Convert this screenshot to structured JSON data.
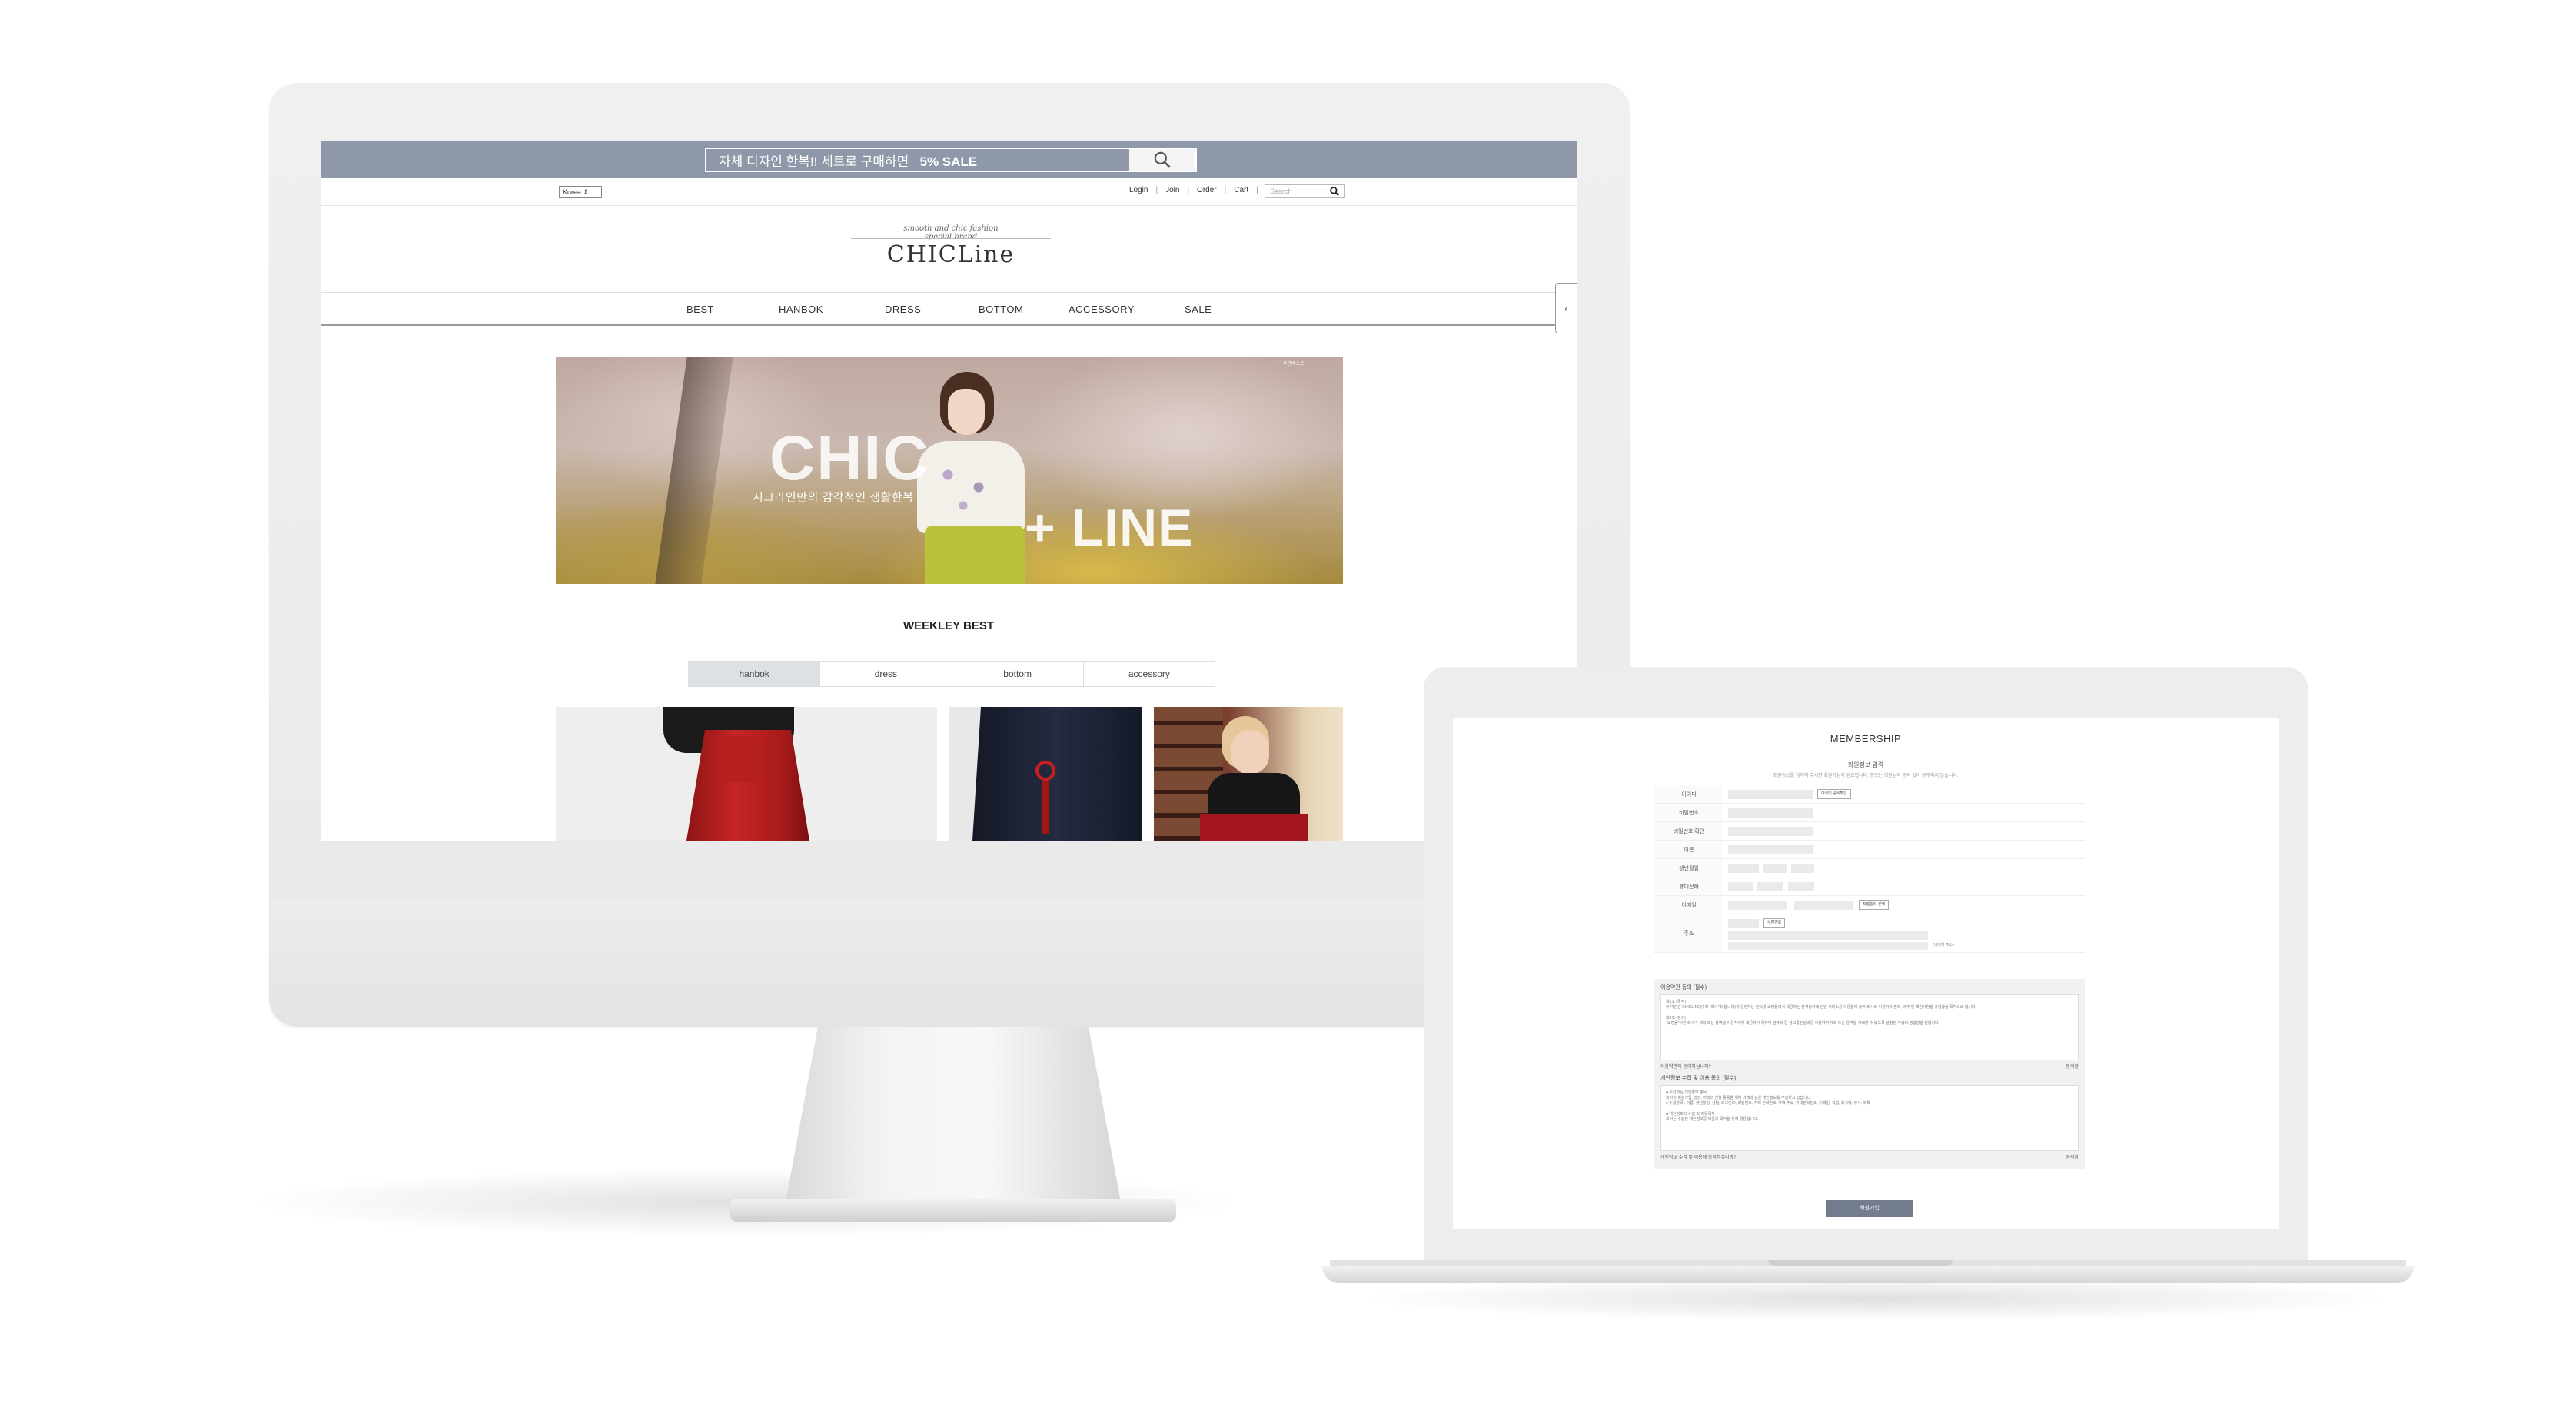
{
  "desktop": {
    "promo": {
      "text": "자체 디자인 한복!! 세트로 구매하면",
      "highlight": "5% SALE"
    },
    "util": {
      "language": "Korea",
      "links": [
        "Login",
        "Join",
        "Order",
        "Cart"
      ],
      "search_placeholder": "Search"
    },
    "logo": {
      "tagline": "smooth and chic fashion special brand",
      "name": "CHICLine"
    },
    "nav": [
      "BEST",
      "HANBOK",
      "DRESS",
      "BOTTOM",
      "ACCESSORY",
      "SALE"
    ],
    "banner": {
      "word1": "CHIC",
      "word2": "+ LINE",
      "subtitle": "시크라인만의 감각적인 생활한복",
      "mini": "주간베스트"
    },
    "weekly": {
      "title": "WEEKLEY BEST",
      "tabs": [
        "hanbok",
        "dress",
        "bottom",
        "accessory"
      ],
      "active_tab": "hanbok"
    },
    "colors": {
      "promo_bar": "#8f98a8",
      "active_tab": "#dde1e4"
    }
  },
  "laptop": {
    "title": "MEMBERSHIP",
    "subtitle": "회원정보 입력",
    "note": "회원정보를 입력해 주시면 회원가입이 완료됩니다. 정보는 회원님의 동의 없이 공개되지 않습니다.",
    "fields": [
      "아이디",
      "비밀번호",
      "비밀번호 확인",
      "이름",
      "생년월일",
      "휴대전화",
      "이메일",
      "주소"
    ],
    "buttons": {
      "check_id": "아이디 중복확인",
      "email_select": "직접입력 선택",
      "zip": "우편번호",
      "submit": "회원가입"
    },
    "address_suffix": "(나머지 주소)",
    "terms": [
      {
        "title": "이용약관 동의 (필수)",
        "lines": [
          "제1조 (목적)",
          "이 약관은 CHICLINE(이하 \"회사\"라 합니다)가 운영하는 인터넷 쇼핑몰에서 제공하는 전자상거래 관련 서비스를 이용함에 있어 회사와 이용자의 권리, 의무 및 책임사항을 규정함을 목적으로 합니다.",
          "제2조 (정의)",
          "\"쇼핑몰\"이란 회사가 재화 또는 용역을 이용자에게 제공하기 위하여 컴퓨터 등 정보통신설비를 이용하여 재화 또는 용역을 거래할 수 있도록 설정한 가상의 영업장을 말합니다."
        ],
        "agree": "이용약관에 동의하십니까?",
        "agree_check": "동의함"
      },
      {
        "title": "개인정보 수집 및 이용 동의 (필수)",
        "lines": [
          "■ 수집하는 개인정보 항목",
          "회사는 회원가입, 상담, 서비스 신청 등등을 위해 아래와 같은 개인정보를 수집하고 있습니다.",
          "ο 수집항목 : 이름, 생년월일, 성별, 로그인ID, 비밀번호, 자택 전화번호, 자택 주소, 휴대전화번호, 이메일, 직업, 회사명, 부서, 직책",
          "■ 개인정보의 수집 및 이용목적",
          "회사는 수집한 개인정보를 다음의 목적을 위해 활용합니다."
        ],
        "agree": "개인정보 수집 및 이용에 동의하십니까?",
        "agree_check": "동의함"
      }
    ],
    "colors": {
      "submit": "#727c8c"
    }
  }
}
